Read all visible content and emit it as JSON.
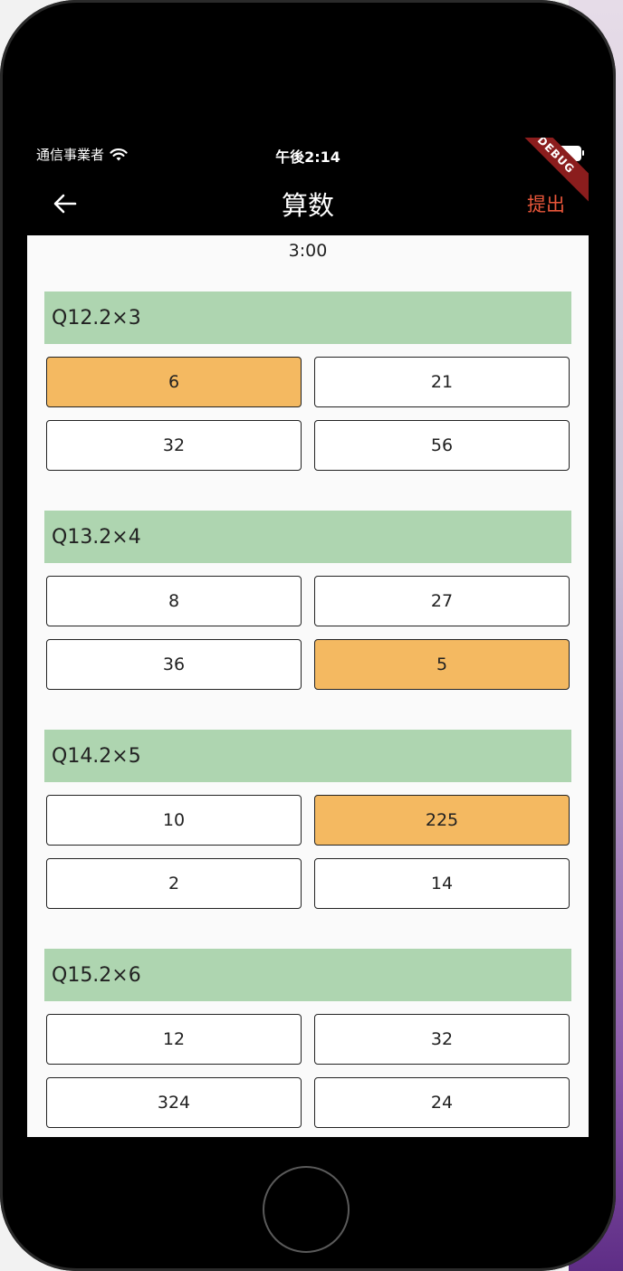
{
  "status_bar": {
    "carrier": "通信事業者",
    "time": "午後2:14"
  },
  "app_bar": {
    "title": "算数",
    "submit_label": "提出",
    "debug_label": "DEBUG"
  },
  "timer": "3:00",
  "questions": [
    {
      "label": "Q12.2×3",
      "answers": [
        "6",
        "21",
        "32",
        "56"
      ],
      "selected_index": 0
    },
    {
      "label": "Q13.2×4",
      "answers": [
        "8",
        "27",
        "36",
        "5"
      ],
      "selected_index": 3
    },
    {
      "label": "Q14.2×5",
      "answers": [
        "10",
        "225",
        "2",
        "14"
      ],
      "selected_index": 1
    },
    {
      "label": "Q15.2×6",
      "answers": [
        "12",
        "32",
        "324",
        "24"
      ],
      "selected_index": null
    }
  ],
  "colors": {
    "question_header": "#aed5b0",
    "selected_answer": "#f4b961",
    "submit": "#e8563a",
    "debug_banner": "#8b1d1d"
  },
  "icons": [
    "wifi-icon",
    "battery-icon",
    "back-arrow-icon"
  ]
}
